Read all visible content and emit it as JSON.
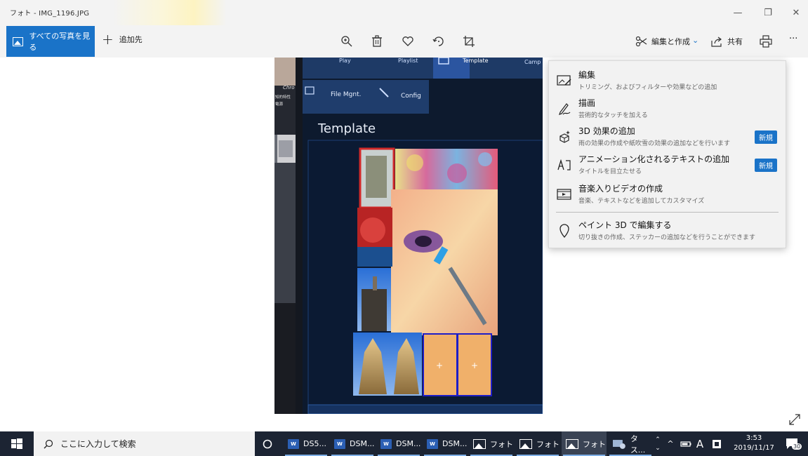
{
  "window": {
    "title": "フォト - IMG_1196.JPG",
    "minimize": "—",
    "restore": "❐",
    "close": "✕"
  },
  "toolbar": {
    "all_photos_label": "すべての写真を見る",
    "add_to_label": "追加先",
    "edit_create_label": "編集と作成",
    "share_label": "共有",
    "more_label": "···",
    "icons": [
      "zoom-icon",
      "delete-icon",
      "heart-icon",
      "rotate-icon",
      "crop-icon",
      "print-icon"
    ]
  },
  "photo_content": {
    "top_tabs": [
      "Play",
      "Playlist",
      "Template",
      "Camp"
    ],
    "side_tabs": [
      "File Mgnt.",
      "Config"
    ],
    "heading": "Template",
    "left_sign_text": [
      "Chro",
      "知的特性",
      "電源"
    ]
  },
  "edit_menu": {
    "items": [
      {
        "title": "編集",
        "subtitle": "トリミング、およびフィルターや効果などの追加",
        "icon": "edit-image-icon",
        "badge": ""
      },
      {
        "title": "描画",
        "subtitle": "芸術的なタッチを加える",
        "icon": "draw-pen-icon",
        "badge": ""
      },
      {
        "title": "3D 効果の追加",
        "subtitle": "雨の効果の作成や紙吹雪の効果の追加などを行います",
        "icon": "3d-effects-icon",
        "badge": "新規"
      },
      {
        "title": "アニメーション化されるテキストの追加",
        "subtitle": "タイトルを目立たせる",
        "icon": "animated-text-icon",
        "badge": "新規"
      },
      {
        "title": "音楽入りビデオの作成",
        "subtitle": "音楽、テキストなどを追加してカスタマイズ",
        "icon": "video-music-icon",
        "badge": ""
      },
      {
        "title": "ペイント 3D で編集する",
        "subtitle": "切り抜きの作成、ステッカーの追加などを行うことができます",
        "icon": "paint3d-icon",
        "badge": ""
      }
    ]
  },
  "taskbar": {
    "search_placeholder": "ここに入力して検索",
    "items": [
      {
        "label": "DS5...",
        "app": "word"
      },
      {
        "label": "DSM...",
        "app": "word"
      },
      {
        "label": "DSM...",
        "app": "word"
      },
      {
        "label": "DSM...",
        "app": "word"
      },
      {
        "label": "フォト",
        "app": "photos"
      },
      {
        "label": "フォト",
        "app": "photos"
      },
      {
        "label": "フォト",
        "app": "photos"
      },
      {
        "label": "タス...",
        "app": "task"
      }
    ],
    "ime_label": "A",
    "time": "3:53",
    "date": "2019/11/17",
    "notification_count": "30"
  },
  "colors": {
    "accent": "#1a73c8",
    "taskbar": "#1c2433",
    "menu_bg": "#f2f2f2"
  }
}
